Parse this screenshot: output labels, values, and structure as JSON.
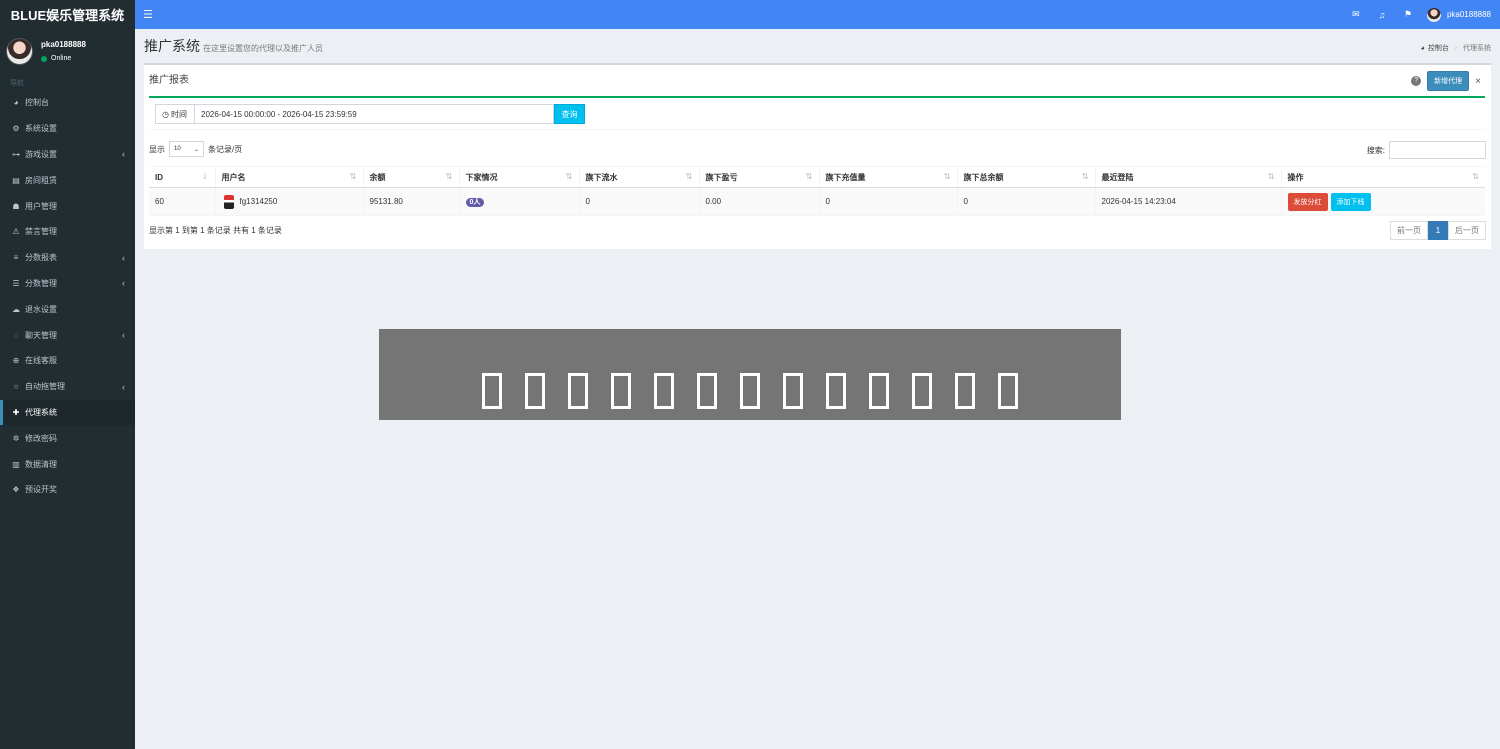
{
  "app": {
    "logo_text": "BLUE娱乐管理系统"
  },
  "sidebar": {
    "user_name": "pka0188888",
    "user_status": "Online",
    "header": "导航",
    "items": [
      {
        "label": "控制台",
        "icon": "dashboard-icon",
        "caret": false
      },
      {
        "label": "系统设置",
        "icon": "cogs-icon",
        "caret": false
      },
      {
        "label": "游戏设置",
        "icon": "gamepad-icon",
        "caret": true
      },
      {
        "label": "房间租赁",
        "icon": "document-icon",
        "caret": false
      },
      {
        "label": "用户管理",
        "icon": "users-icon",
        "caret": false
      },
      {
        "label": "禁言管理",
        "icon": "warning-icon",
        "caret": false
      },
      {
        "label": "分数报表",
        "icon": "list-icon",
        "caret": true
      },
      {
        "label": "分数管理",
        "icon": "database-icon",
        "caret": true
      },
      {
        "label": "退水设置",
        "icon": "cloud-icon",
        "caret": false
      },
      {
        "label": "聊天管理",
        "icon": "chat-icon",
        "caret": true
      },
      {
        "label": "在线客服",
        "icon": "lifebuoy-icon",
        "caret": false
      },
      {
        "label": "自动拖管理",
        "icon": "comment-icon",
        "caret": true
      },
      {
        "label": "代理系统",
        "icon": "user-plus-icon",
        "caret": false,
        "active": true
      },
      {
        "label": "修改密码",
        "icon": "gear-icon",
        "caret": false
      },
      {
        "label": "数据清理",
        "icon": "trash-icon",
        "caret": false
      },
      {
        "label": "预设开奖",
        "icon": "cubes-icon",
        "caret": false
      }
    ]
  },
  "topbar": {
    "user_name": "pka0188888"
  },
  "header": {
    "title": "推广系统",
    "subtitle": "在这里设置您的代理以及推广人员",
    "breadcrumb_home": "控制台",
    "breadcrumb_current": "代理系统"
  },
  "box": {
    "title": "推广报表",
    "new_button": "新增代理",
    "filter_label": "时间",
    "filter_value": "2026-04-15 00:00:00 - 2026-04-15 23:59:59",
    "query_button": "查询",
    "length_prefix": "显示",
    "length_value": "10",
    "length_suffix": "条记录/页",
    "search_label": "搜索:"
  },
  "table": {
    "columns": [
      "ID",
      "用户名",
      "余额",
      "下家情况",
      "旗下流水",
      "旗下盈亏",
      "旗下充值量",
      "旗下总余额",
      "最近登陆",
      "操作"
    ],
    "rows": [
      {
        "id": "60",
        "username": "fg1314250",
        "balance": "95131.80",
        "downline": "0人",
        "flow": "0",
        "profit": "0.00",
        "recharge": "0",
        "total_balance": "0",
        "last_login": "2026-04-15 14:23:04",
        "action1": "发放分红",
        "action2": "添加下线"
      }
    ]
  },
  "footer": {
    "info": "显示第 1 到第 1 条记录 共有 1 条记录",
    "prev": "前一页",
    "page": "1",
    "next": "后一页"
  },
  "colors": {
    "accent": "#4285f4",
    "sidebar": "#222d32",
    "success": "#00a65a",
    "danger": "#dd4b39",
    "info": "#00c0ef"
  }
}
